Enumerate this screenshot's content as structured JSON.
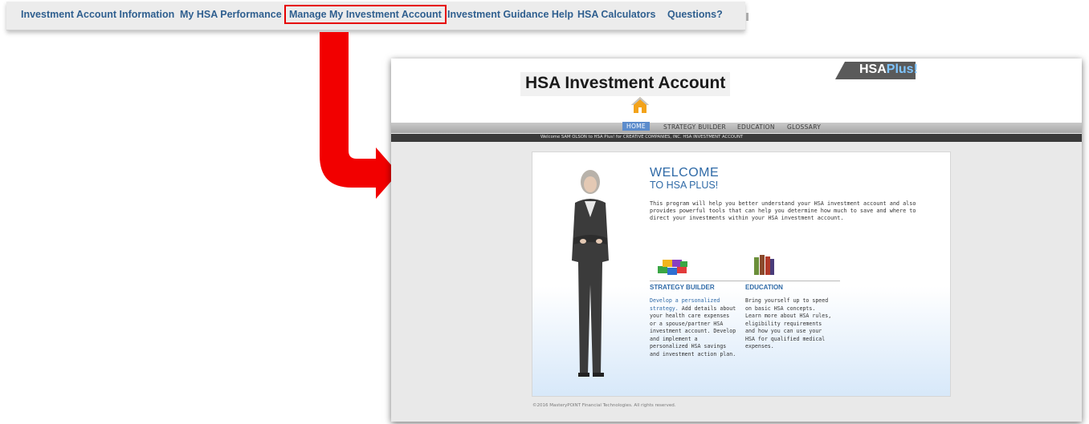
{
  "top_nav": {
    "items": [
      {
        "label": "Investment Account Information"
      },
      {
        "label": "My HSA Performance"
      },
      {
        "label": "Manage My Investment Account",
        "highlighted": true
      },
      {
        "label": "Investment Guidance Help"
      },
      {
        "label": "HSA Calculators"
      },
      {
        "label": "Questions?"
      }
    ]
  },
  "colors": {
    "highlight": "#e60000",
    "nav_text": "#2f5f8f",
    "accent_blue": "#2f6aa7",
    "active_menu": "#5c8ccc"
  },
  "app": {
    "brand_hsa": "HSA",
    "brand_plus": "Plus!",
    "title": "HSA Investment Account",
    "home_icon": "house-icon"
  },
  "menu": {
    "items": [
      {
        "label": "HOME",
        "active": true
      },
      {
        "label": "STRATEGY BUILDER"
      },
      {
        "label": "EDUCATION"
      },
      {
        "label": "GLOSSARY"
      }
    ]
  },
  "welcome_bar": "Welcome SAM OLSON to HSA Plus! for CREATIVE COMPANIES, INC. HSA INVESTMENT ACCOUNT",
  "main": {
    "heading": "WELCOME",
    "subheading": "TO HSA PLUS!",
    "intro": "This program will help you better understand your HSA investment account and also provides powerful tools that can help you determine how much to save and where to direct your investments within your HSA investment account.",
    "sections": [
      {
        "icon": "building-blocks-icon",
        "title": "STRATEGY BUILDER",
        "link_text": "Develop a personalized strategy.",
        "text": "Add details about your health care expenses or a spouse/partner HSA investment account. Develop and implement a personalized HSA savings and investment action plan."
      },
      {
        "icon": "books-icon",
        "title": "EDUCATION",
        "link_text": "",
        "text": "Bring yourself up to speed on basic HSA concepts. Learn more about HSA rules, eligibility requirements and how you can use your HSA for qualified medical expenses."
      }
    ]
  },
  "footer": {
    "copyright": "©2016 MasteryPOINT Financial Technologies. All rights reserved."
  }
}
